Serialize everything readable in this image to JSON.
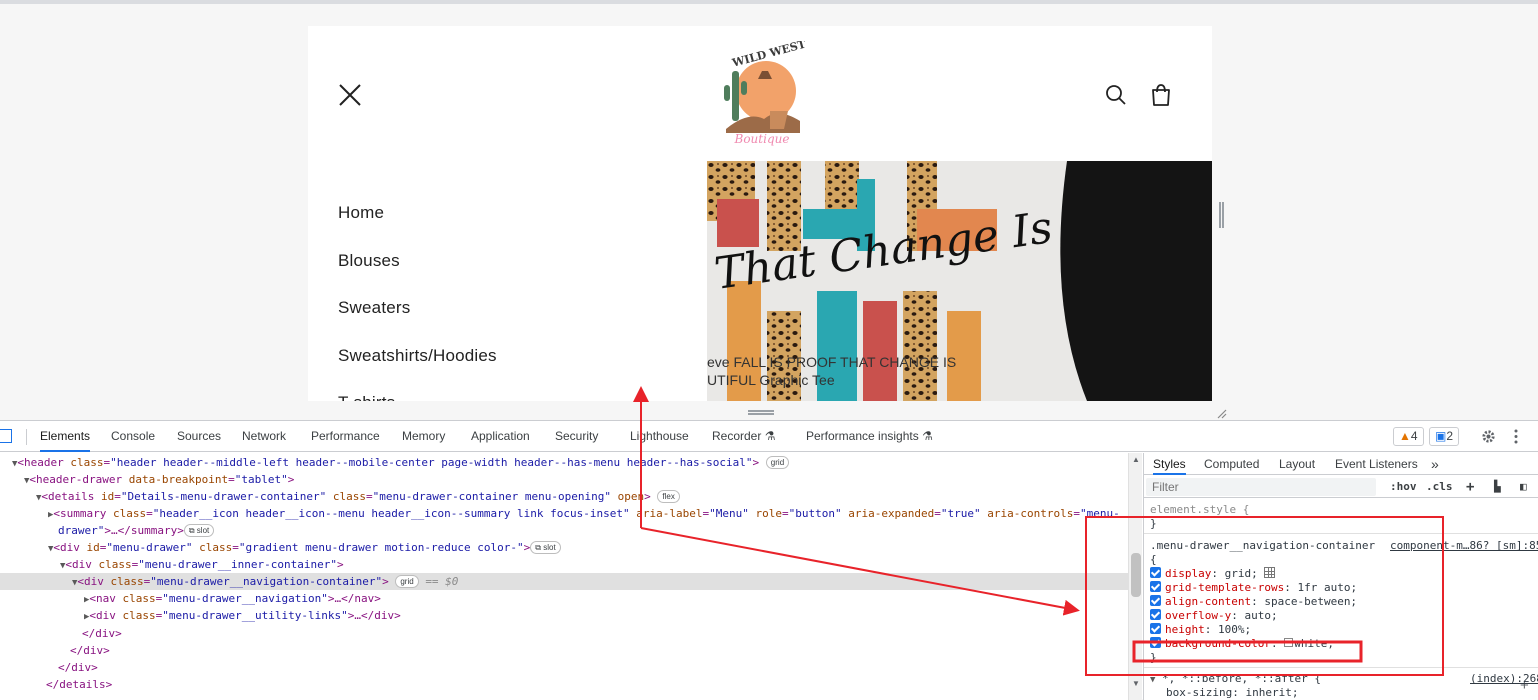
{
  "site": {
    "logo_text_top": "WILD WEST",
    "logo_text_bottom": "Boutique",
    "menu_items": [
      "Home",
      "Blouses",
      "Sweaters",
      "Sweatshirts/Hoodies",
      "T-shirts"
    ],
    "product_script_text": "That Change Is",
    "product_caption_line1": "eve FALL IS PROOF THAT CHANGE IS",
    "product_caption_line2": "UTIFUL Graphic Tee"
  },
  "devtools": {
    "tabs": [
      "Elements",
      "Console",
      "Sources",
      "Network",
      "Performance",
      "Memory",
      "Application",
      "Security",
      "Lighthouse",
      "Recorder",
      "Performance insights"
    ],
    "warnings_count": "4",
    "messages_count": "2",
    "dom": {
      "l1_tag": "<header",
      "l1_attr": "class",
      "l1_val": "\"header header--middle-left header--mobile-center page-width header--has-menu header--has-social\"",
      "l1_badge": "grid",
      "l2_tag": "<header-drawer",
      "l2_attr": "data-breakpoint",
      "l2_val": "\"tablet\"",
      "l3_tag": "<details",
      "l3_attr1": "id",
      "l3_val1": "\"Details-menu-drawer-container\"",
      "l3_attr2": "class",
      "l3_val2": "\"menu-drawer-container menu-opening\"",
      "l3_attr3": "open",
      "l3_badge": "flex",
      "l4_tag": "<summary",
      "l4_attr1": "class",
      "l4_val1": "\"header__icon header__icon--menu header__icon--summary link focus-inset\"",
      "l4_attr2": "aria-label",
      "l4_val2": "\"Menu\"",
      "l4_attr3": "role",
      "l4_val3": "\"button\"",
      "l4_attr4": "aria-expanded",
      "l4_val4": "\"true\"",
      "l4_attr5": "aria-controls",
      "l4_val5": "\"menu-",
      "l4b_val": "drawer\"",
      "l4b_tail": ">…</summary>",
      "slot_badge": "slot",
      "l5_tag": "<div",
      "l5_attr1": "id",
      "l5_val1": "\"menu-drawer\"",
      "l5_attr2": "class",
      "l5_val2": "\"gradient menu-drawer motion-reduce color-\"",
      "l6_tag": "<div",
      "l6_attr": "class",
      "l6_val": "\"menu-drawer__inner-container\"",
      "l7_tag": "<div",
      "l7_attr": "class",
      "l7_val": "\"menu-drawer__navigation-container\"",
      "l7_badge": "grid",
      "l7_eq": "== $0",
      "l8_tag": "<nav",
      "l8_attr": "class",
      "l8_val": "\"menu-drawer__navigation\"",
      "l8_tail": ">…</nav>",
      "l9_tag": "<div",
      "l9_attr": "class",
      "l9_val": "\"menu-drawer__utility-links\"",
      "l9_tail": ">…</div>",
      "close_div": "</div>",
      "close_details": "</details>"
    },
    "styles": {
      "sub_tabs": [
        "Styles",
        "Computed",
        "Layout",
        "Event Listeners"
      ],
      "filter_placeholder": "Filter",
      "hov": ":hov",
      "cls": ".cls",
      "element_style": "element.style {",
      "close_brace": "}",
      "open_brace": "{",
      "selector": ".menu-drawer__navigation-container",
      "source": "component-m…86? [sm]:85",
      "props": [
        {
          "name": "display",
          "value": "grid;"
        },
        {
          "name": "grid-template-rows",
          "value": "1fr auto;"
        },
        {
          "name": "align-content",
          "value": "space-between;"
        },
        {
          "name": "overflow-y",
          "value": "auto;"
        },
        {
          "name": "height",
          "value": "100%;"
        },
        {
          "name": "background-color",
          "value": "white;"
        }
      ],
      "next_selector": "*, *::before, *::after {",
      "next_source": "(index):268",
      "next_prop": "box-sizing: inherit;"
    }
  },
  "colors": {
    "annotation_red": "#e8232a",
    "accent_blue": "#1a73e8"
  }
}
